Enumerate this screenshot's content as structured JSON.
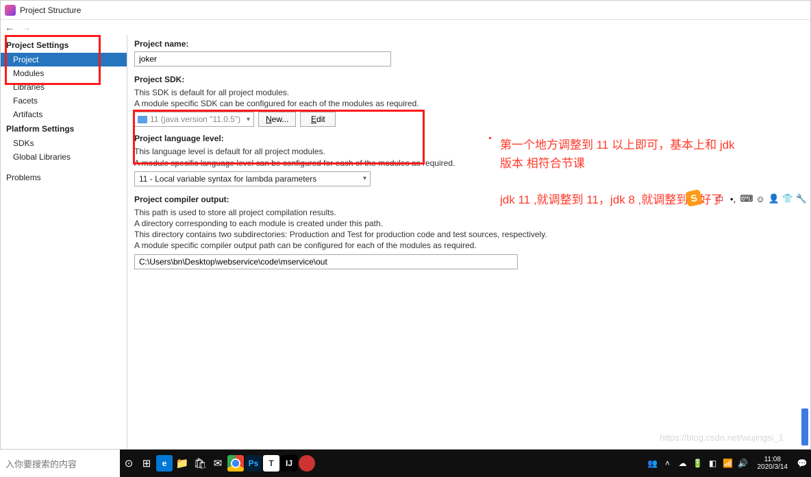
{
  "titlebar": {
    "title": "Project Structure"
  },
  "sidebar": {
    "group1": "Project Settings",
    "items1": [
      "Project",
      "Modules",
      "Libraries",
      "Facets",
      "Artifacts"
    ],
    "group2": "Platform Settings",
    "items2": [
      "SDKs",
      "Global Libraries"
    ],
    "group3": "Problems"
  },
  "content": {
    "project_name_label": "Project name:",
    "project_name_value": "joker",
    "sdk_label": "Project SDK:",
    "sdk_desc1": "This SDK is default for all project modules.",
    "sdk_desc2": "A module specific SDK can be configured for each of the modules as required.",
    "sdk_value": "11 (java version \"11.0.5\")",
    "new_btn": "New...",
    "edit_btn": "Edit",
    "lang_label": "Project language level:",
    "lang_desc1": "This language level is default for all project modules.",
    "lang_desc2": "A module specific language level can be configured for each of the modules as required.",
    "lang_value": "11 - Local variable syntax for lambda parameters",
    "compiler_label": "Project compiler output:",
    "compiler_desc1": "This path is used to store all project compilation results.",
    "compiler_desc2": "A directory corresponding to each module is created under this path.",
    "compiler_desc3": "This directory contains two subdirectories: Production and Test for production code and test sources, respectively.",
    "compiler_desc4": "A module specific compiler output path can be configured for each of the modules as required.",
    "compiler_value": "C:\\Users\\bn\\Desktop\\webservice\\code\\mservice\\out"
  },
  "annotation": {
    "line1": "第一个地方调整到 11 以上即可，基本上和 jdk 版本 相符合节课",
    "line2": "jdk 11 ,就调整到 11，jdk 8 ,就调整到就好了"
  },
  "watermark": "https://blog.csdn.net/wujingsi_1",
  "taskbar": {
    "search_placeholder": "入你要搜索的内容",
    "time": "11:08",
    "date": "2020/3/14"
  }
}
